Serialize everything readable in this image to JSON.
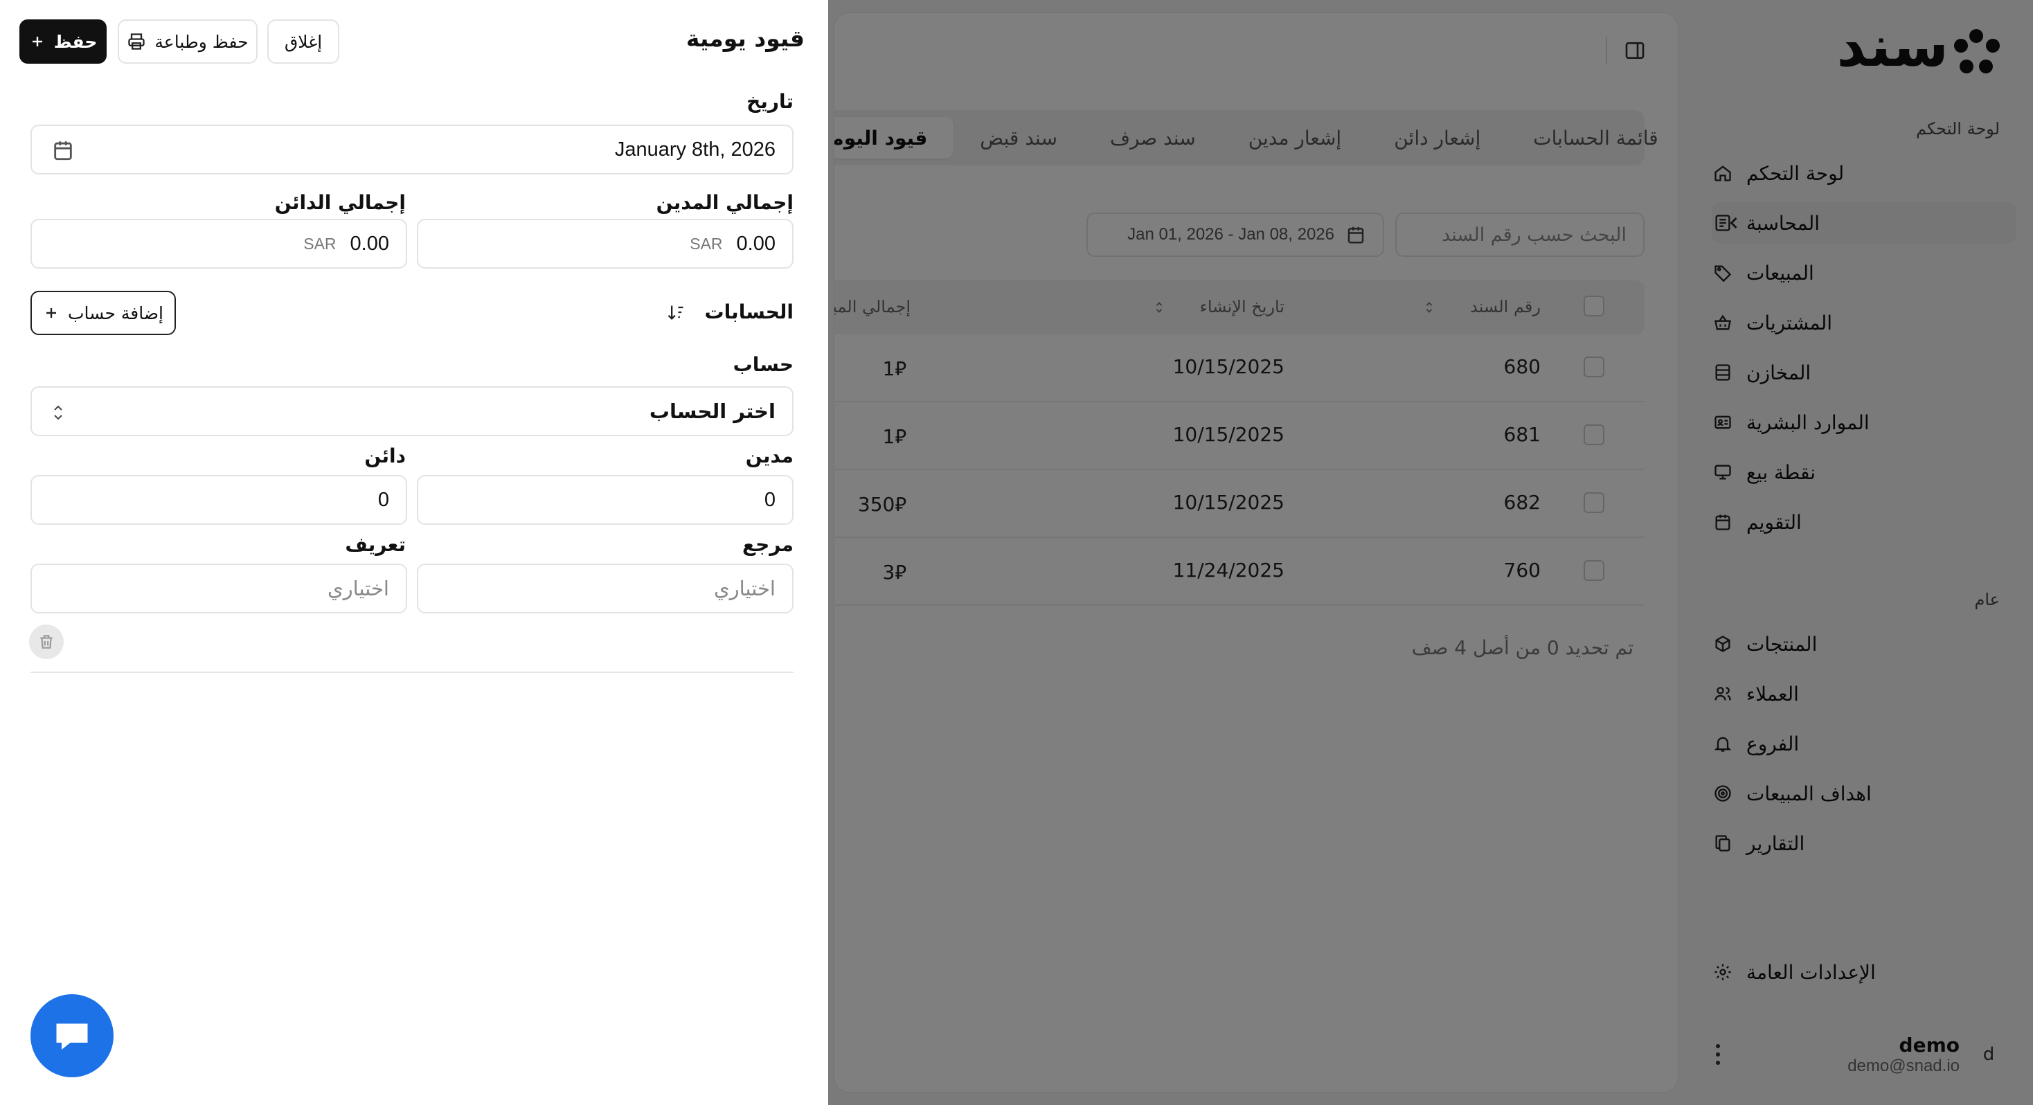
{
  "app": {
    "brand": "سند",
    "accent": "#1e72e8"
  },
  "sidebar": {
    "section_main": "لوحة التحكم",
    "items": [
      {
        "label": "لوحة التحكم",
        "icon": "home-icon"
      },
      {
        "label": "المحاسبة",
        "icon": "ledger-icon"
      },
      {
        "label": "المبيعات",
        "icon": "tag-icon"
      },
      {
        "label": "المشتريات",
        "icon": "basket-icon"
      },
      {
        "label": "المخازن",
        "icon": "warehouse-icon"
      },
      {
        "label": "الموارد البشرية",
        "icon": "hr-icon"
      },
      {
        "label": "نقطة بيع",
        "icon": "monitor-icon"
      },
      {
        "label": "التقويم",
        "icon": "calendar-icon"
      }
    ],
    "section_general": "عام",
    "general_items": [
      {
        "label": "المنتجات",
        "icon": "box-icon"
      },
      {
        "label": "العملاء",
        "icon": "users-icon"
      },
      {
        "label": "الفروع",
        "icon": "bell-icon"
      },
      {
        "label": "اهداف المبيعات",
        "icon": "target-icon"
      },
      {
        "label": "التقارير",
        "icon": "copy-icon"
      }
    ],
    "settings": "الإعدادات العامة",
    "user": {
      "initial": "d",
      "name": "demo",
      "email": "demo@snad.io"
    }
  },
  "main": {
    "tabs": [
      "قيود اليومية",
      "سند قبض",
      "سند صرف",
      "إشعار مدين",
      "إشعار دائن",
      "قائمة الحسابات"
    ],
    "search_placeholder": "البحث حسب رقم السند",
    "date_range": "Jan 01, 2026 - Jan 08, 2026",
    "table": {
      "headers": {
        "number": "رقم السند",
        "created": "تاريخ الإنشاء",
        "total": "إجمالي المبلغ"
      },
      "rows": [
        {
          "number": "680",
          "date": "10/15/2025",
          "amount": "1"
        },
        {
          "number": "681",
          "date": "10/15/2025",
          "amount": "1"
        },
        {
          "number": "682",
          "date": "10/15/2025",
          "amount": "350"
        },
        {
          "number": "760",
          "date": "11/24/2025",
          "amount": "3"
        }
      ],
      "currency_symbol": "⃁"
    },
    "rows_selected": "تم تحديد 0 من أصل 4 صف"
  },
  "drawer": {
    "title": "قيود يومية",
    "save": "حفظ",
    "save_print": "حفظ وطباعة",
    "close": "إغلاق",
    "date_label": "تاريخ",
    "date_value": "January 8th, 2026",
    "debit_total_label": "إجمالي المدين",
    "credit_total_label": "إجمالي الدائن",
    "currency": "SAR",
    "debit_total": "0.00",
    "credit_total": "0.00",
    "accounts_label": "الحسابات",
    "add_account": "إضافة حساب",
    "account_label": "حساب",
    "account_placeholder": "اختر الحساب",
    "debit_label": "مدين",
    "credit_label": "دائن",
    "debit_value": "0",
    "credit_value": "0",
    "reference_label": "مرجع",
    "description_label": "تعريف",
    "optional": "اختياري"
  }
}
